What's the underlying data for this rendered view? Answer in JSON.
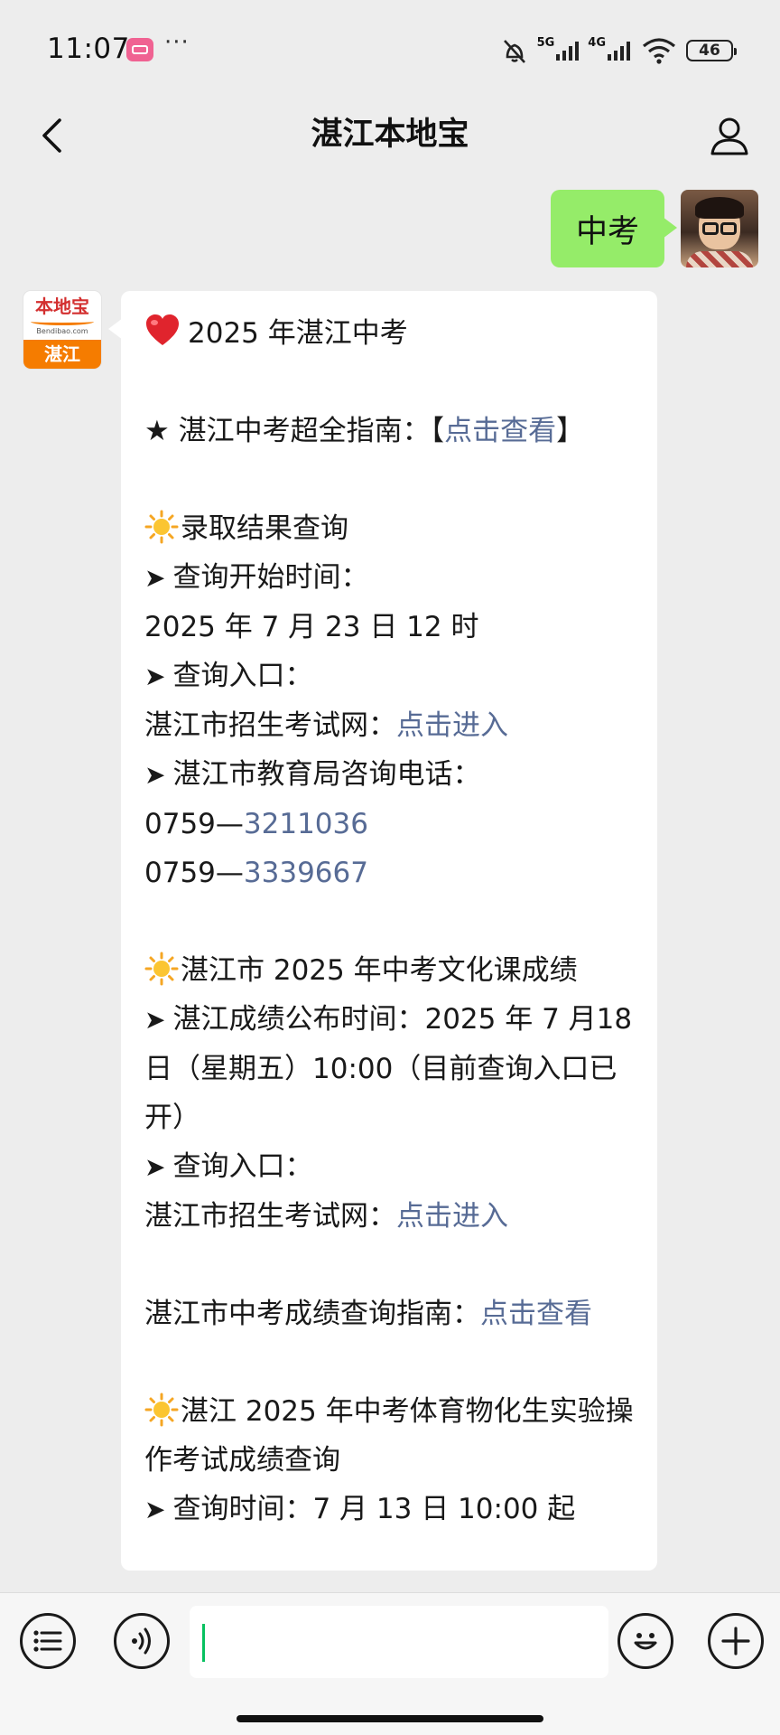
{
  "status_bar": {
    "time": "11:07",
    "dots": "···",
    "net_5g": "5G",
    "net_4g": "4G",
    "battery": "46"
  },
  "nav": {
    "title": "湛江本地宝"
  },
  "outgoing": {
    "text": "中考"
  },
  "bot_avatar": {
    "brand": "本地宝",
    "url": "Bendibao.com",
    "city": "湛江"
  },
  "message": {
    "title": "2025 年湛江中考",
    "guide_prefix": "★ 湛江中考超全指南：【",
    "guide_link": "点击查看",
    "guide_suffix": "】",
    "s1_title": "录取结果查询",
    "s1_time_label": "查询开始时间：",
    "s1_time_value": "2025 年 7 月 23 日 12 时",
    "s1_entry_label": "查询入口：",
    "s1_entry_site": "湛江市招生考试网：",
    "s1_entry_link": "点击进入",
    "s1_phone_label": "湛江市教育局咨询电话：",
    "s1_phone1_prefix": "0759—",
    "s1_phone1_num": "3211036",
    "s1_phone2_prefix": "0759—",
    "s1_phone2_num": "3339667",
    "s2_title": "湛江市 2025 年中考文化课成绩",
    "s2_time": "湛江成绩公布时间：2025 年 7 月18 日（星期五）10:00（目前查询入口已开）",
    "s2_entry_label": "查询入口：",
    "s2_entry_site": "湛江市招生考试网：",
    "s2_entry_link": "点击进入",
    "s2_guide_text": "湛江市中考成绩查询指南：",
    "s2_guide_link": "点击查看",
    "s3_title": "湛江 2025 年中考体育物化生实验操作考试成绩查询",
    "s3_time": "查询时间：7 月 13 日 10:00 起"
  }
}
